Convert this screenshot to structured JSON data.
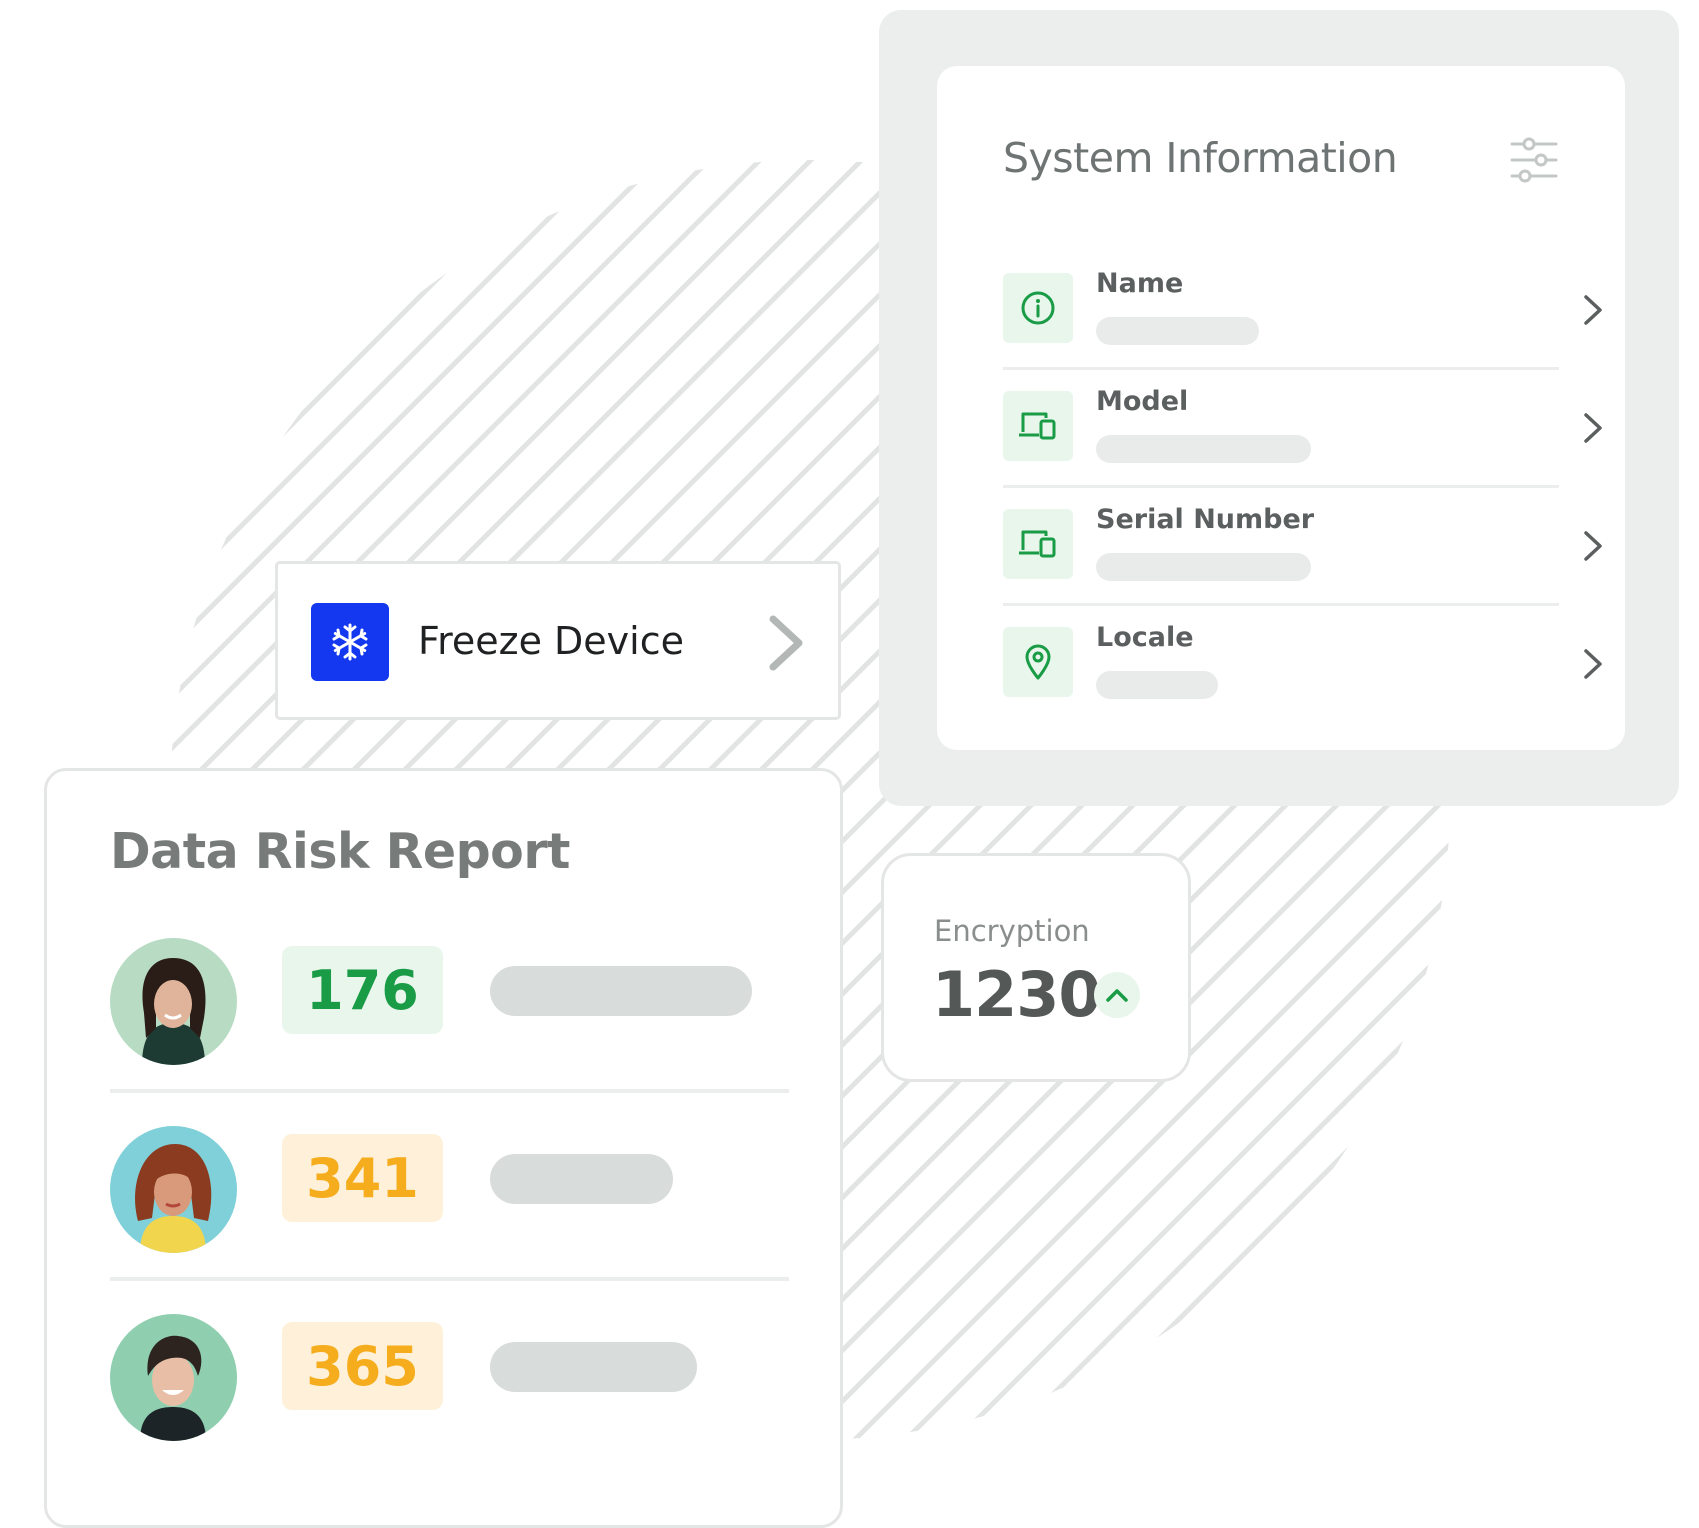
{
  "system_info": {
    "title": "System Information",
    "rows": [
      {
        "label": "Name",
        "icon": "info-icon"
      },
      {
        "label": "Model",
        "icon": "devices-icon"
      },
      {
        "label": "Serial Number",
        "icon": "devices-icon"
      },
      {
        "label": "Locale",
        "icon": "location-pin-icon"
      }
    ]
  },
  "freeze": {
    "label": "Freeze Device",
    "icon": "snowflake-icon"
  },
  "risk_report": {
    "title": "Data Risk Report",
    "rows": [
      {
        "score": "176",
        "status": "green"
      },
      {
        "score": "341",
        "status": "amber"
      },
      {
        "score": "365",
        "status": "amber"
      }
    ]
  },
  "encryption": {
    "label": "Encryption",
    "value": "1230",
    "trend": "up"
  },
  "colors": {
    "accent_green": "#1a9b46",
    "accent_amber": "#f5ad1e",
    "freeze_blue": "#1437f0",
    "muted_text": "#6e7473"
  }
}
